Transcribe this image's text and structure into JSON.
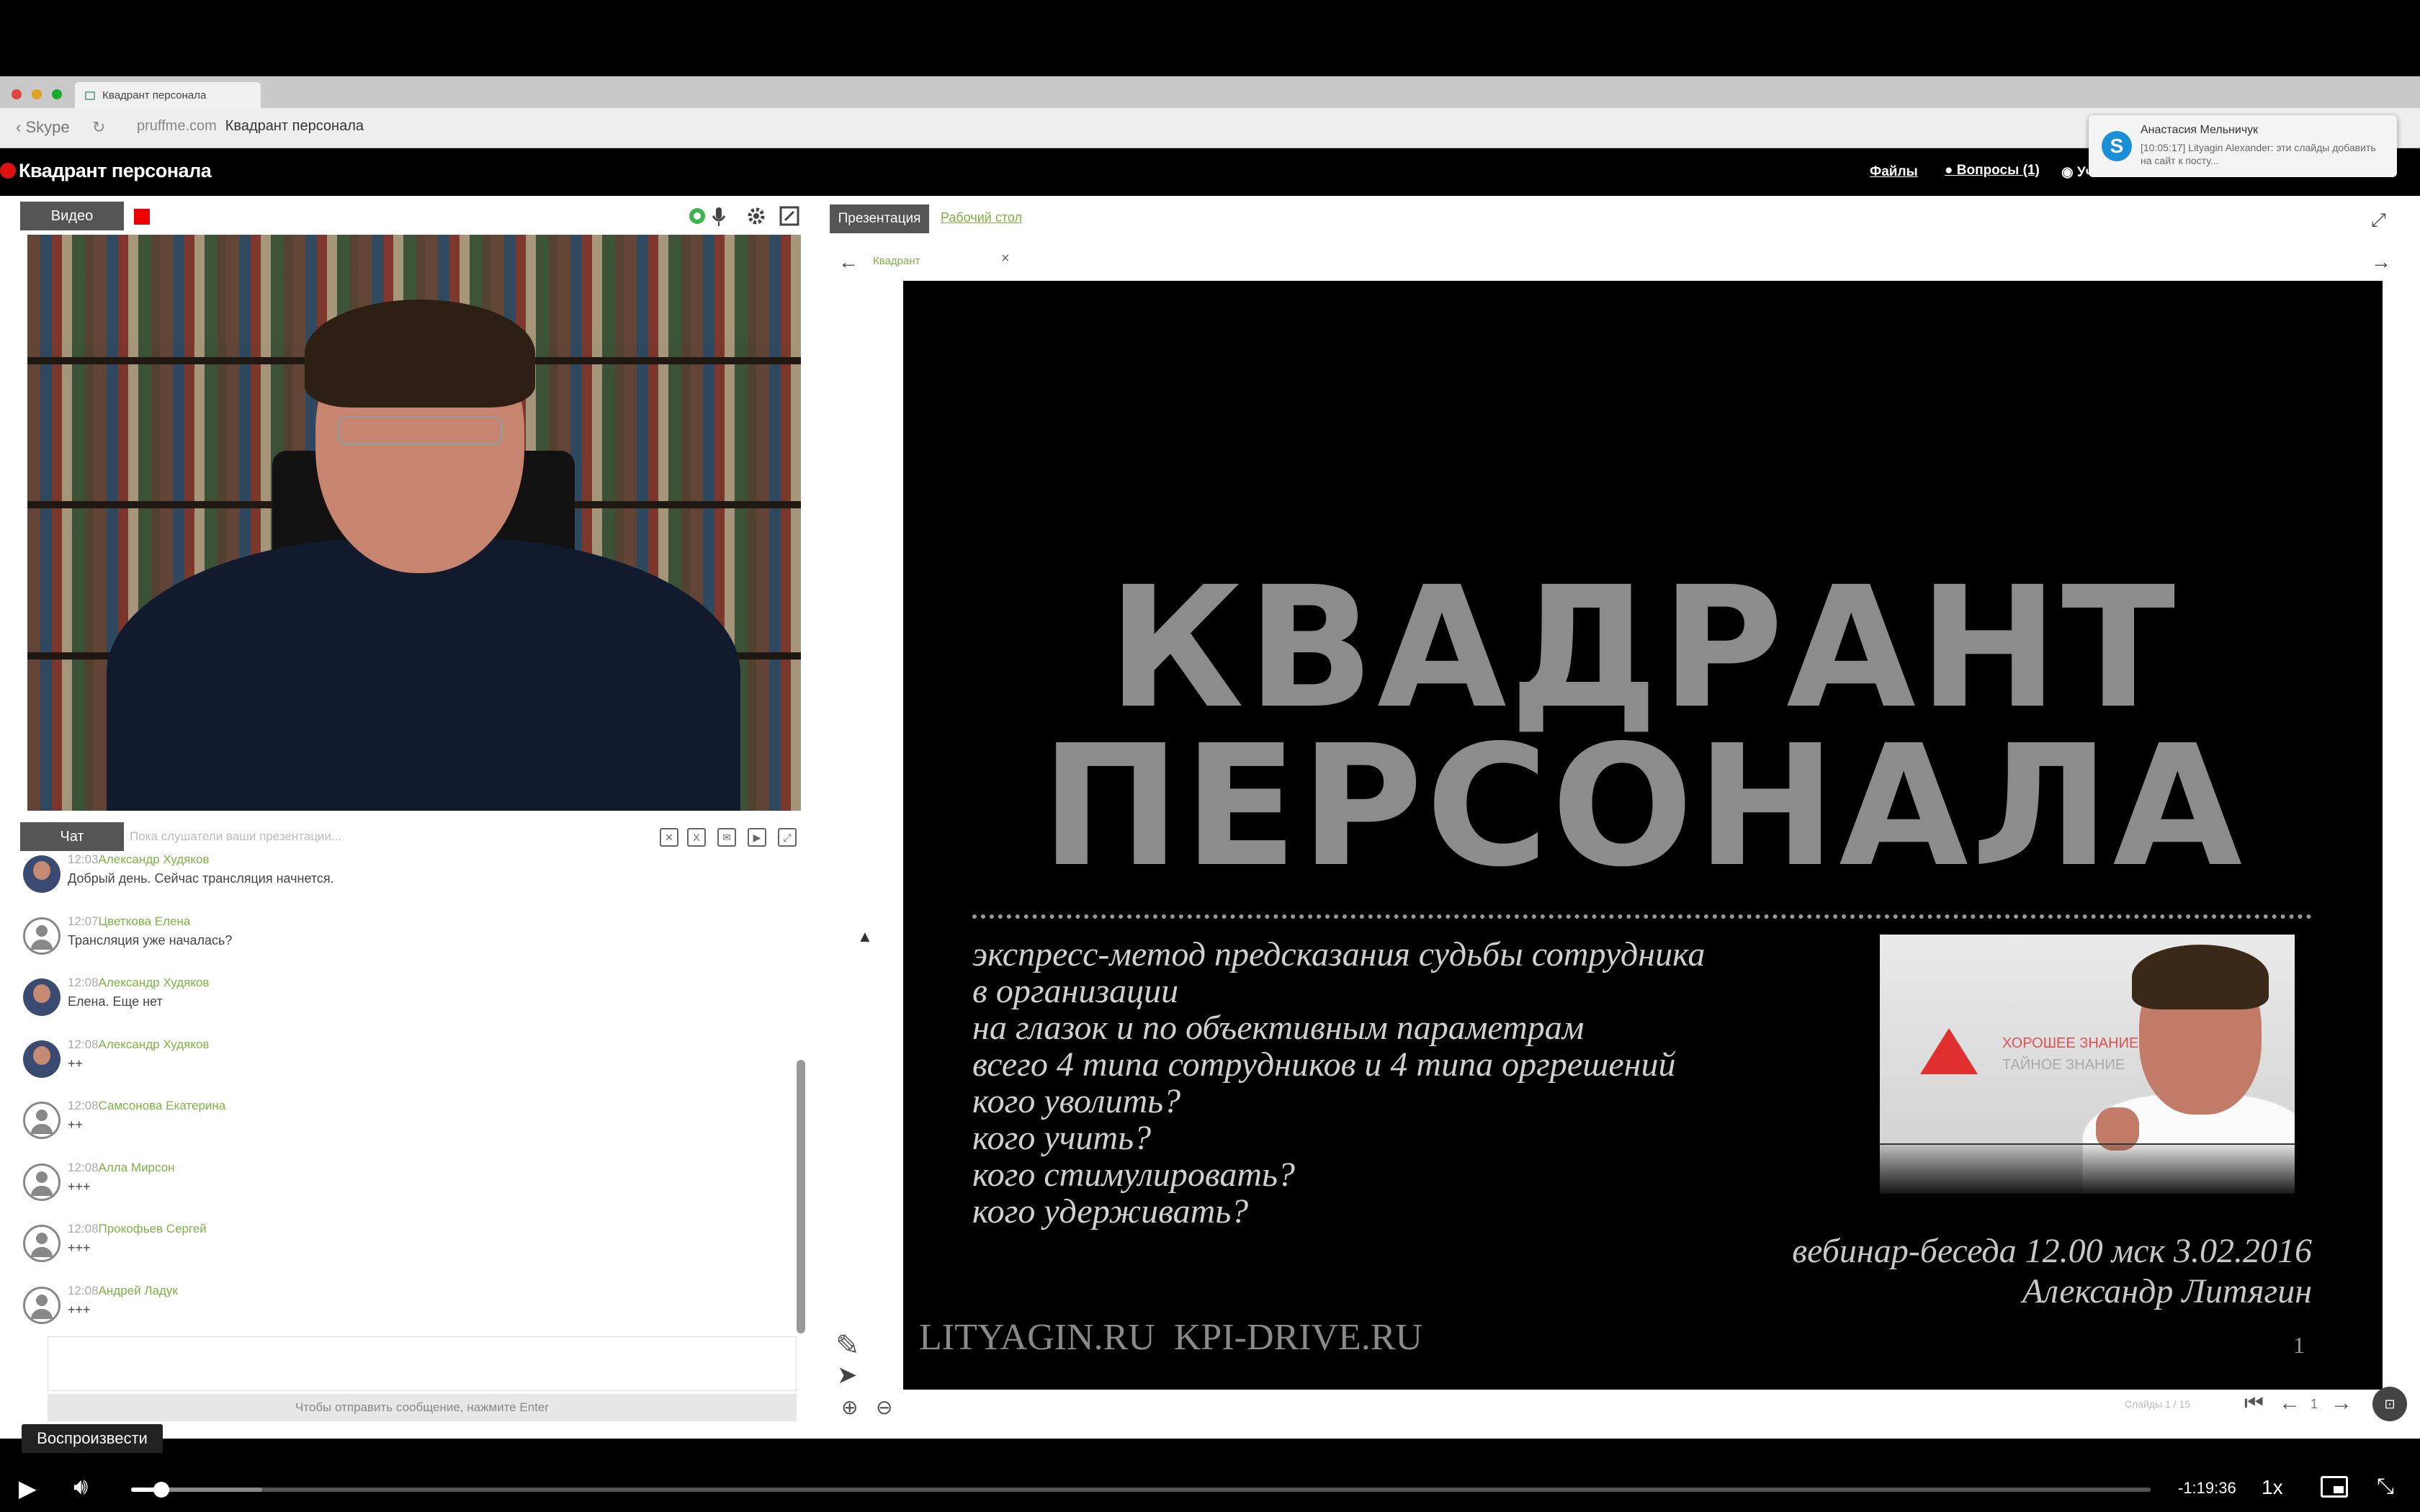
{
  "browser": {
    "tab_title": "Квадрант персонала",
    "back_label": "Skype",
    "url_domain": "pruffme.com",
    "url_page": "Квадрант персонала"
  },
  "app": {
    "title": "Квадрант персонала",
    "nav_files": "Файлы",
    "nav_questions": "Вопросы (1)",
    "nav_more": "Уч"
  },
  "notification": {
    "title": "Анастасия Мельничук",
    "body": "[10:05:17] Lityagin Alexander: эти слайды добавить на сайт к посту..."
  },
  "video_panel": {
    "tab_label": "Видео"
  },
  "chat": {
    "tab_label": "Чат",
    "search_placeholder": "Пока слушатели ваши презентации...",
    "hint": "Чтобы отправить сообщение, нажмите Enter",
    "messages": [
      {
        "time": "12:03",
        "author": "Александр Худяков",
        "text": "Добрый день. Сейчас трансляция начнется.",
        "avatar": "photo"
      },
      {
        "time": "12:07",
        "author": "Цветкова Елена",
        "text": "Трансляция уже началась?",
        "avatar": "generic"
      },
      {
        "time": "12:08",
        "author": "Александр Худяков",
        "text": "Елена. Еще нет",
        "avatar": "photo"
      },
      {
        "time": "12:08",
        "author": "Александр Худяков",
        "text": "++",
        "avatar": "photo"
      },
      {
        "time": "12:08",
        "author": "Самсонова Екатерина",
        "text": "++",
        "avatar": "generic"
      },
      {
        "time": "12:08",
        "author": "Алла Мирсон",
        "text": "+++",
        "avatar": "generic"
      },
      {
        "time": "12:08",
        "author": "Прокофьев Сергей",
        "text": "+++",
        "avatar": "generic"
      },
      {
        "time": "12:08",
        "author": "Андрей Ладук",
        "text": "+++",
        "avatar": "generic"
      }
    ]
  },
  "presentation": {
    "tab_label": "Презентация",
    "desk_label": "Рабочий стол",
    "doc_tab": "Квадрант",
    "slides_label": "Слайды 1 / 15",
    "page": "1"
  },
  "slide": {
    "title_line1": "КВАДРАНТ",
    "title_line2": "ПЕРСОНАЛА",
    "bullets": [
      "экспресс-метод предсказания судьбы сотрудника",
      "в организации",
      "на глазок и по объективным параметрам",
      "всего 4 типа сотрудников и 4 типа оргрешений",
      "кого уволить?",
      "кого учить?",
      "кого стимулировать?",
      "кого удерживать?"
    ],
    "date_line": "вебинар-беседа 12.00 мск 3.02.2016",
    "author_line": "Александр Литягин",
    "sites": "LITYAGIN.RU  KPI-DRIVE.RU",
    "number": "1",
    "photo_text1": "ХОРОШЕЕ ЗНАНИЕ",
    "photo_text2": "ТАЙНОЕ ЗНАНИЕ"
  },
  "player": {
    "tooltip": "Воспроизвести",
    "time_remaining": "-1:19:36",
    "speed": "1x",
    "progress": 0.015,
    "buffered": 0.065
  }
}
